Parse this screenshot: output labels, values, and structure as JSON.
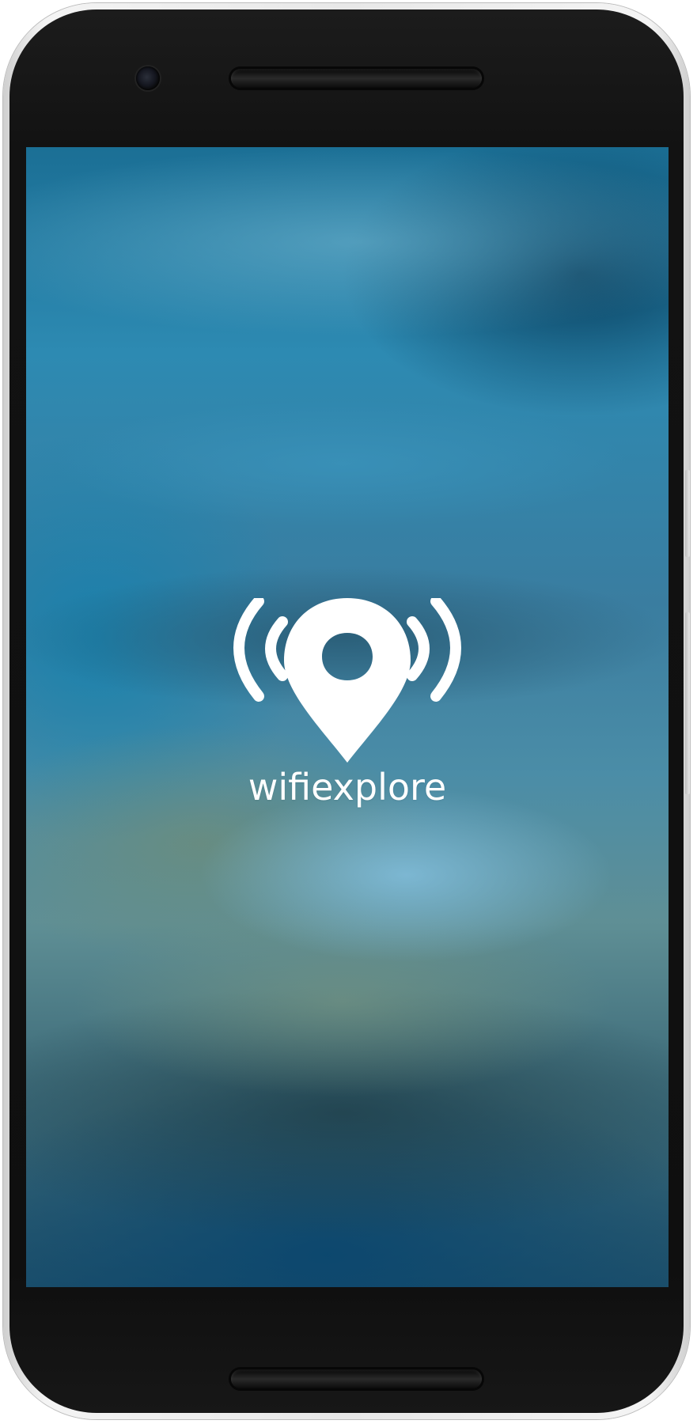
{
  "app": {
    "name": "wifiexplore",
    "logo_icon": "wifi-location-pin-icon",
    "logo_color": "#ffffff"
  },
  "device": {
    "frame_color": "#eaeaea",
    "bezel_color": "#111111"
  },
  "screen": {
    "state": "splash",
    "background_colors": [
      "#1b6f95",
      "#4b8da7",
      "#5f8f95",
      "#1d4f6a"
    ]
  }
}
